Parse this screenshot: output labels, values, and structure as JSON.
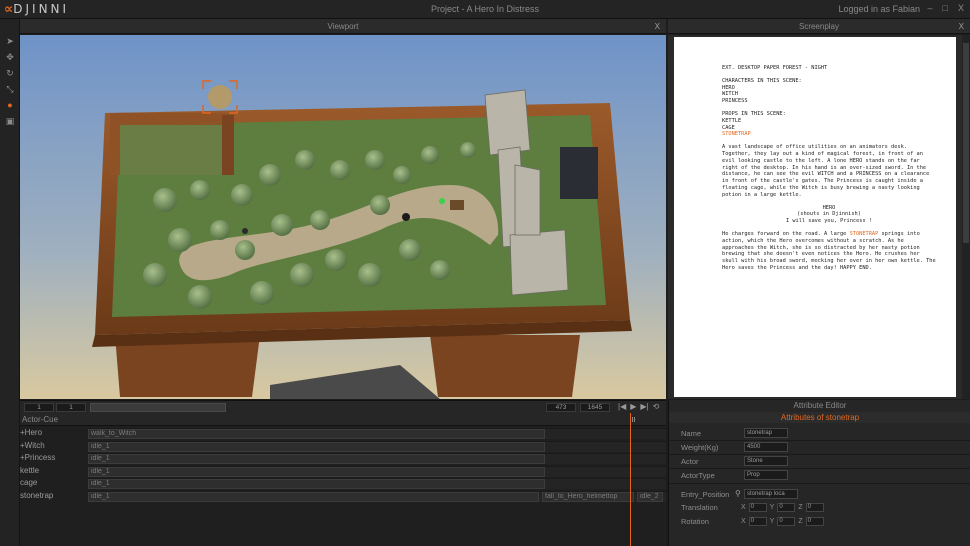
{
  "app": {
    "brand": "DJINNI",
    "title": "Project - A Hero In Distress",
    "user": "Logged in as Fabian",
    "window_buttons": [
      "–",
      "□",
      "X"
    ]
  },
  "tools": [
    {
      "name": "select-arrow-icon",
      "glyph": "➤"
    },
    {
      "name": "move-icon",
      "glyph": "✥"
    },
    {
      "name": "rotate-icon",
      "glyph": "↻"
    },
    {
      "name": "scale-icon",
      "glyph": "⤡"
    },
    {
      "name": "place-pin-icon",
      "glyph": "●"
    },
    {
      "name": "camera-icon",
      "glyph": "▣"
    }
  ],
  "viewport": {
    "title": "Viewport",
    "close": "X"
  },
  "screenplay": {
    "title": "Screenplay",
    "close": "X",
    "heading": "EXT. DESKTOP PAPER FOREST - NIGHT",
    "characters_title": "CHARACTERS IN THIS SCENE:",
    "characters": [
      "HERO",
      "WITCH",
      "PRINCESS"
    ],
    "props_title": "PROPS IN THIS SCENE:",
    "props": [
      "KETTLE",
      "CAGE"
    ],
    "props_highlight": "STONETRAP",
    "action1": "A vast landscape of office utilities on an animators desk. Together, they lay out a kind of magical forest, in front of an evil looking castle to the left. A lone HERO stands on the far right of the desktop. In his hand is an over-sized sword. In the distance, he can see the evil WITCH and a PRINCESS on a clearance in front of the castle's gates. The Princess is caught inside a floating cage, while the Witch is busy brewing a nasty looking potion in a large kettle.",
    "dialogue_character": "HERO",
    "dialogue_paren": "(shouts in Djinnish)",
    "dialogue_line": "I will save you, Princess !",
    "action2_a": "He charges forward on the road. A large",
    "action2_hl": "STONETRAP",
    "action2_b": "springs into action, which the Hero overcomes without a scratch. As he approaches the Witch, she is so distracted by her nasty potion brewing that she doesn't even notices the Hero. He crushes her skull with his broad sword, mocking her over in her own kettle. The Hero saves the Princess and the day! HAPPY END."
  },
  "timebar": {
    "start": "1",
    "end": "1",
    "frame_a": "473",
    "frame_b": "1645",
    "transport": [
      "|◀",
      "▶",
      "▶|",
      "⟲"
    ]
  },
  "tracks": {
    "header": "Actor-Cue",
    "rows": [
      {
        "name": "+Hero",
        "clips": [
          {
            "label": "walk_to_Witch",
            "start": 0,
            "end": 0.79
          }
        ]
      },
      {
        "name": "+Witch",
        "clips": [
          {
            "label": "idle_1",
            "start": 0,
            "end": 0.79
          }
        ]
      },
      {
        "name": "+Princess",
        "clips": [
          {
            "label": "idle_1",
            "start": 0,
            "end": 0.79
          }
        ]
      },
      {
        "name": "kettle",
        "clips": [
          {
            "label": "idle_1",
            "start": 0,
            "end": 0.79
          }
        ]
      },
      {
        "name": "cage",
        "clips": [
          {
            "label": "idle_1",
            "start": 0,
            "end": 0.79
          }
        ]
      },
      {
        "name": "stonetrap",
        "clips": [
          {
            "label": "idle_1",
            "start": 0,
            "end": 0.78
          },
          {
            "label": "fall_to_Hero_helmettop",
            "start": 0.785,
            "end": 0.945
          },
          {
            "label": "idle_2",
            "start": 0.95,
            "end": 0.995
          }
        ]
      }
    ]
  },
  "attributes": {
    "title": "Attribute Editor",
    "subtitle": "Attributes of stonetrap",
    "fields": [
      {
        "key": "Name",
        "value": "stonetrap"
      },
      {
        "key": "Weight(Kg)",
        "value": "4500"
      },
      {
        "key": "Actor",
        "value": "Stone"
      },
      {
        "key": "ActorType",
        "value": "Prop"
      }
    ],
    "entry_position": {
      "key": "Entry_Position",
      "value": "stonetrap loca"
    },
    "translation": {
      "key": "Translation",
      "x": "0",
      "y": "0",
      "z": "0"
    },
    "rotation": {
      "key": "Rotation",
      "x": "0",
      "y": "0",
      "z": "0"
    }
  },
  "colors": {
    "accent": "#e2661f",
    "background": "#1d1d1d",
    "panel": "#262626"
  }
}
